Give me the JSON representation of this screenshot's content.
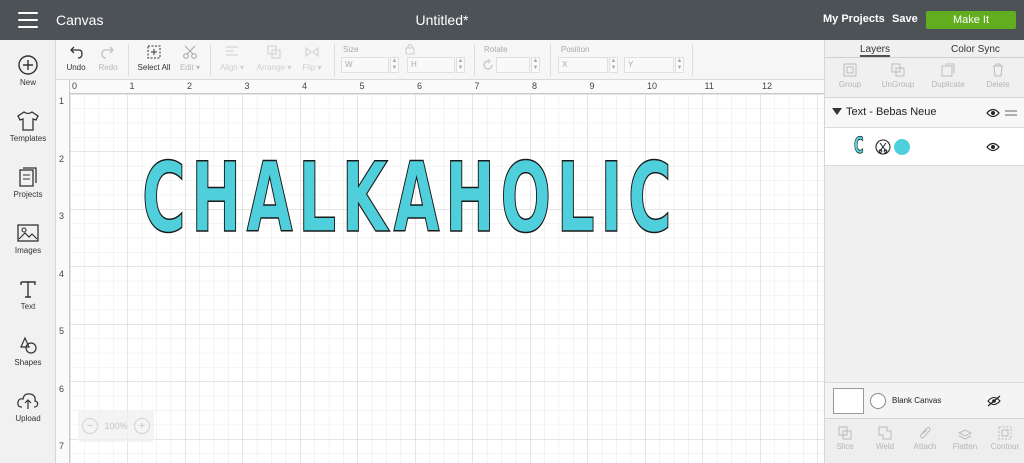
{
  "topbar": {
    "app_title": "Canvas",
    "doc_title": "Untitled*",
    "my_projects": "My Projects",
    "save": "Save",
    "make_it": "Make It"
  },
  "sidebar": {
    "items": [
      {
        "label": "New",
        "icon": "plus-circle-icon"
      },
      {
        "label": "Templates",
        "icon": "tshirt-icon"
      },
      {
        "label": "Projects",
        "icon": "projects-icon"
      },
      {
        "label": "Images",
        "icon": "image-icon"
      },
      {
        "label": "Text",
        "icon": "text-icon"
      },
      {
        "label": "Shapes",
        "icon": "shapes-icon"
      },
      {
        "label": "Upload",
        "icon": "upload-icon"
      }
    ]
  },
  "toolbar": {
    "undo": "Undo",
    "redo": "Redo",
    "select_all": "Select All",
    "edit": "Edit",
    "align": "Align",
    "arrange": "Arrange",
    "flip": "Flip",
    "size_label": "Size",
    "w_label": "W",
    "h_label": "H",
    "rotate_label": "Rotate",
    "position_label": "Position",
    "x_label": "X",
    "y_label": "Y"
  },
  "canvas": {
    "ruler_top": [
      "0",
      "1",
      "2",
      "3",
      "4",
      "5",
      "6",
      "7",
      "8",
      "9",
      "10",
      "11",
      "12"
    ],
    "ruler_left": [
      "1",
      "2",
      "3",
      "4",
      "5",
      "6",
      "7"
    ],
    "design_text": "CHALKAHOLIC",
    "design_fill": "#4fcfdc",
    "design_stroke": "#1a1a1a",
    "zoom": "100%"
  },
  "rpanel": {
    "tab_layers": "Layers",
    "tab_color_sync": "Color Sync",
    "tools": [
      "Group",
      "UnGroup",
      "Duplicate",
      "Delete"
    ],
    "layer_group_name": "Text - Bebas Neue",
    "layer_item_glyph": "C",
    "layer_color": "#4fcfdc",
    "blank_canvas": "Blank Canvas",
    "bottom_tools": [
      "Slice",
      "Weld",
      "Attach",
      "Flatten",
      "Contour"
    ]
  },
  "colors": {
    "topbar": "#4d5257",
    "make_it": "#62ad1f"
  }
}
